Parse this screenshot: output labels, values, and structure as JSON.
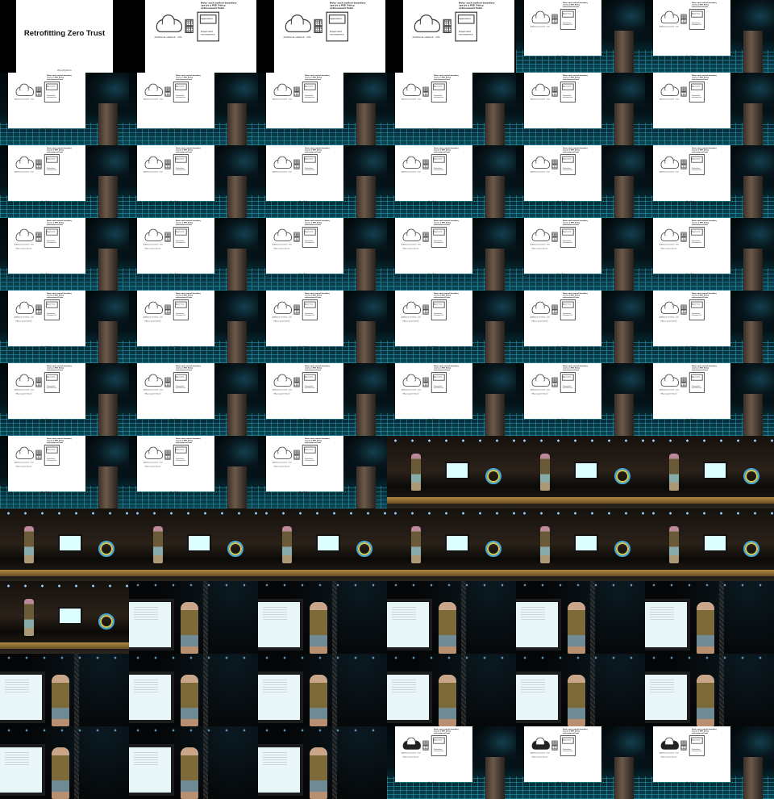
{
  "title_slide": {
    "title": "Retrofitting Zero Trust"
  },
  "diagram": {
    "note_1": "Note: each control boundary",
    "note_2": "can be a PEP. Policy",
    "note_3": "enforcement Point",
    "app_label": "Application",
    "dep_label_1": "Dependent",
    "dep_label_2": "microservice",
    "caption": "Additional network - mTL",
    "question": "Why is speed ahead",
    "brand_word": "EuroPython"
  },
  "frames": [
    "title",
    "full",
    "full",
    "full",
    "stage",
    "stage",
    "stage",
    "stage",
    "stage",
    "stage",
    "stage",
    "stage",
    "stage",
    "stage",
    "stage",
    "stage",
    "stage",
    "stage",
    "stage-q",
    "stage-q",
    "stage-q",
    "stage-q",
    "stage-q",
    "stage-q",
    "stage-q",
    "stage-q",
    "stage-q",
    "stage-q",
    "stage-q",
    "stage-q",
    "stage-q",
    "stage-q",
    "stage-q",
    "stage-q",
    "stage-q",
    "stage-q",
    "stage-q",
    "stage-q",
    "stage-q",
    "wide",
    "wide",
    "wide",
    "wide",
    "wide",
    "wide",
    "wide",
    "wide",
    "wide",
    "wide",
    "close",
    "close",
    "close",
    "close",
    "close",
    "close",
    "close",
    "close",
    "close",
    "close",
    "close",
    "close",
    "close",
    "close",
    "stage-b",
    "stage-b",
    "stage-b"
  ]
}
